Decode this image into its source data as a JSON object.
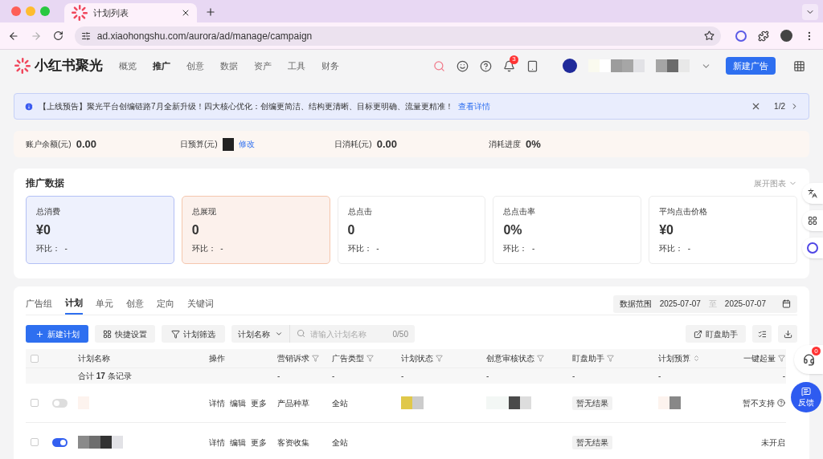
{
  "browser": {
    "tab_title": "计划列表",
    "url": "ad.xiaohongshu.com/aurora/ad/manage/campaign"
  },
  "app": {
    "logo": "小红书聚光",
    "nav": [
      {
        "label": "概览",
        "selected": false
      },
      {
        "label": "推广",
        "selected": true
      },
      {
        "label": "创意",
        "selected": false
      },
      {
        "label": "数据",
        "selected": false
      },
      {
        "label": "资产",
        "selected": false
      },
      {
        "label": "工具",
        "selected": false
      },
      {
        "label": "财务",
        "selected": false
      }
    ],
    "notification_count": "3",
    "create_button": "新建广告"
  },
  "notice": {
    "text": "【上线预告】聚光平台创编链路7月全新升级！四大核心优化：创编更简洁、结构更清晰、目标更明确、流量更精准！",
    "link": "查看详情",
    "pager": "1/2"
  },
  "account": [
    {
      "label": "账户余额(元)",
      "value": "0.00"
    },
    {
      "label": "日预算(元)",
      "link": "修改"
    },
    {
      "label": "日消耗(元)",
      "value": "0.00"
    },
    {
      "label": "消耗进度",
      "value": "0%"
    }
  ],
  "stats": {
    "title": "推广数据",
    "expand": "展开图表",
    "cards": [
      {
        "label": "总消费",
        "value": "¥0",
        "compare": "环比：  -",
        "color": "#eef1fd"
      },
      {
        "label": "总展现",
        "value": "0",
        "compare": "环比：  -",
        "color": "#fcf1ec"
      },
      {
        "label": "总点击",
        "value": "0",
        "compare": "环比：  -",
        "color": "#ffffff"
      },
      {
        "label": "总点击率",
        "value": "0%",
        "compare": "环比：  -",
        "color": "#ffffff"
      },
      {
        "label": "平均点击价格",
        "value": "¥0",
        "compare": "环比：  -",
        "color": "#ffffff"
      }
    ]
  },
  "tabs": [
    {
      "label": "广告组",
      "selected": false
    },
    {
      "label": "计划",
      "selected": true
    },
    {
      "label": "单元",
      "selected": false
    },
    {
      "label": "创意",
      "selected": false
    },
    {
      "label": "定向",
      "selected": false
    },
    {
      "label": "关键词",
      "selected": false
    }
  ],
  "date_range": {
    "label": "数据范围",
    "start": "2025-07-07",
    "separator": "至",
    "end": "2025-07-07"
  },
  "toolbar": {
    "create": "新建计划",
    "quick": "快捷设置",
    "filter": "计划筛选",
    "search_type": "计划名称",
    "search": {
      "placeholder": "请输入计划名称",
      "count": "0/50"
    },
    "assistant": "盯盘助手"
  },
  "table": {
    "all_checked": false,
    "columns": [
      {
        "label": "计划名称",
        "kind": "plain"
      },
      {
        "label": "操作",
        "kind": "plain"
      },
      {
        "label": "营销诉求",
        "kind": "filter"
      },
      {
        "label": "广告类型",
        "kind": "filter"
      },
      {
        "label": "计划状态",
        "kind": "filter"
      },
      {
        "label": "创意审核状态",
        "kind": "filter"
      },
      {
        "label": "盯盘助手",
        "kind": "filter"
      },
      {
        "label": "计划预算",
        "kind": "sort"
      },
      {
        "label": "一键起量",
        "kind": "filter"
      }
    ],
    "summary": [
      "合计 **17** 条记录",
      "-",
      "-",
      "-",
      "-",
      "-",
      "-",
      "-"
    ],
    "rows": [
      {
        "checked": false,
        "on": false,
        "actions": [
          "详情",
          "编辑",
          "更多"
        ],
        "goal": "产品种草",
        "type": "全站",
        "assistant": "暂无结果",
        "boost": "暂不支持",
        "boost_help": true
      },
      {
        "checked": false,
        "on": true,
        "actions": [
          "详情",
          "编辑",
          "更多"
        ],
        "goal": "客资收集",
        "type": "全站",
        "assistant": "暂无结果",
        "boost": "未开启",
        "boost_help": false
      }
    ]
  },
  "side": {
    "support_count": "0",
    "feedback": "反馈"
  }
}
